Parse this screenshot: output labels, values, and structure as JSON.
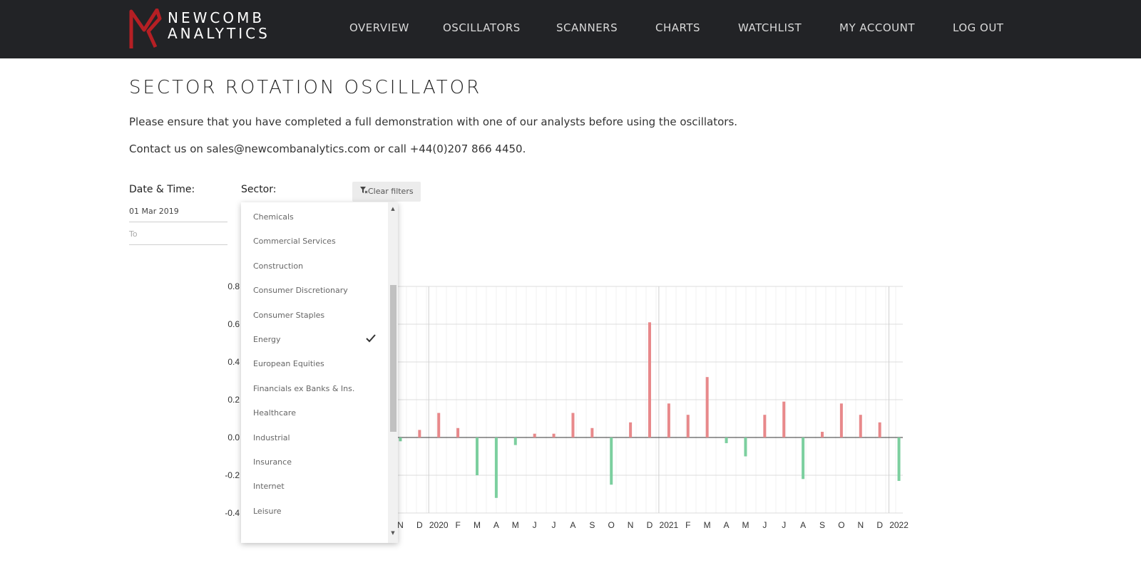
{
  "header": {
    "logo_line1": "NEWCOMB",
    "logo_line2": "ANALYTICS",
    "nav": [
      "OVERVIEW",
      "OSCILLATORS",
      "SCANNERS",
      "CHARTS",
      "WATCHLIST",
      "MY ACCOUNT",
      "LOG OUT"
    ]
  },
  "colors": {
    "header_bg": "#222326",
    "logo_red": "#b51f24",
    "positive": "#e8898b",
    "negative": "#7ccf9f"
  },
  "page": {
    "title": "SECTOR ROTATION OSCILLATOR",
    "intro1": "Please ensure that you have completed a full demonstration with one of our analysts before using the oscillators.",
    "intro2": "Contact us on sales@newcombanalytics.com or call +44(0)207 866 4450."
  },
  "filters": {
    "date_label": "Date & Time:",
    "date_from": "01 Mar 2019",
    "date_to_placeholder": "To",
    "sector_label": "Sector:",
    "clear_label": "Clear filters"
  },
  "sector_dropdown": {
    "items": [
      {
        "label": "Chemicals",
        "selected": false
      },
      {
        "label": "Commercial Services",
        "selected": false
      },
      {
        "label": "Construction",
        "selected": false
      },
      {
        "label": "Consumer Discretionary",
        "selected": false
      },
      {
        "label": "Consumer Staples",
        "selected": false
      },
      {
        "label": "Energy",
        "selected": true
      },
      {
        "label": "European Equities",
        "selected": false
      },
      {
        "label": "Financials ex Banks & Ins.",
        "selected": false
      },
      {
        "label": "Healthcare",
        "selected": false
      },
      {
        "label": "Industrial",
        "selected": false
      },
      {
        "label": "Insurance",
        "selected": false
      },
      {
        "label": "Internet",
        "selected": false
      },
      {
        "label": "Leisure",
        "selected": false
      }
    ]
  },
  "chart_data": {
    "type": "bar",
    "ylim": [
      -0.4,
      0.8
    ],
    "y_ticks": [
      "0.8",
      "0.6",
      "0.4",
      "0.2",
      "0.0",
      "-0.2",
      "-0.4"
    ],
    "x_ticks": [
      "N",
      "D",
      "2020",
      "F",
      "M",
      "A",
      "M",
      "J",
      "J",
      "A",
      "S",
      "O",
      "N",
      "D",
      "2021",
      "F",
      "M",
      "A",
      "M",
      "J",
      "J",
      "A",
      "S",
      "O",
      "N",
      "D",
      "2022"
    ],
    "series": [
      {
        "x": [
          "2019-11",
          "2019-12",
          "2020-01",
          "2020-02",
          "2020-03",
          "2020-04",
          "2020-05",
          "2020-06",
          "2020-07",
          "2020-08",
          "2020-09",
          "2020-10",
          "2020-11",
          "2020-12",
          "2021-01",
          "2021-02",
          "2021-03",
          "2021-04",
          "2021-05",
          "2021-06",
          "2021-07",
          "2021-08",
          "2021-09",
          "2021-10",
          "2021-11",
          "2021-12",
          "2022-01"
        ],
        "values": [
          -0.02,
          0.04,
          0.13,
          0.05,
          -0.2,
          -0.32,
          -0.04,
          0.02,
          0.02,
          0.13,
          0.05,
          -0.25,
          0.08,
          0.61,
          0.18,
          0.12,
          0.32,
          -0.03,
          -0.1,
          0.12,
          0.19,
          -0.22,
          0.03,
          0.18,
          0.12,
          0.08,
          -0.23
        ]
      }
    ],
    "grid": true
  }
}
